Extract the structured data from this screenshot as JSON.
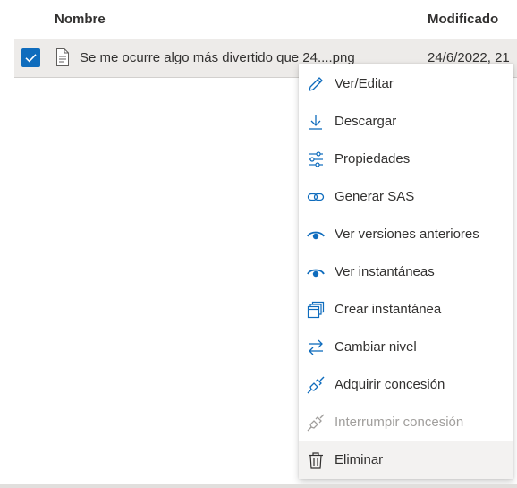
{
  "columns": {
    "name": "Nombre",
    "modified": "Modificado"
  },
  "row": {
    "selected": true,
    "file_name": "Se me ocurre algo más divertido que 24....png",
    "modified": "24/6/2022, 21"
  },
  "menu": {
    "items": [
      {
        "label": "Ver/Editar",
        "icon": "pencil-icon",
        "enabled": true
      },
      {
        "label": "Descargar",
        "icon": "download-icon",
        "enabled": true
      },
      {
        "label": "Propiedades",
        "icon": "properties-icon",
        "enabled": true
      },
      {
        "label": "Generar SAS",
        "icon": "link-icon",
        "enabled": true
      },
      {
        "label": "Ver versiones anteriores",
        "icon": "eye-icon",
        "enabled": true
      },
      {
        "label": "Ver instantáneas",
        "icon": "eye-icon",
        "enabled": true
      },
      {
        "label": "Crear instantánea",
        "icon": "snapshot-icon",
        "enabled": true
      },
      {
        "label": "Cambiar nivel",
        "icon": "swap-icon",
        "enabled": true
      },
      {
        "label": "Adquirir concesión",
        "icon": "plug-icon",
        "enabled": true
      },
      {
        "label": "Interrumpir concesión",
        "icon": "plug-icon",
        "enabled": false
      },
      {
        "label": "Eliminar",
        "icon": "trash-icon",
        "enabled": true
      }
    ]
  },
  "colors": {
    "accent": "#0f6cbd",
    "disabled": "#a19f9d",
    "row_selected": "#edebe9"
  }
}
